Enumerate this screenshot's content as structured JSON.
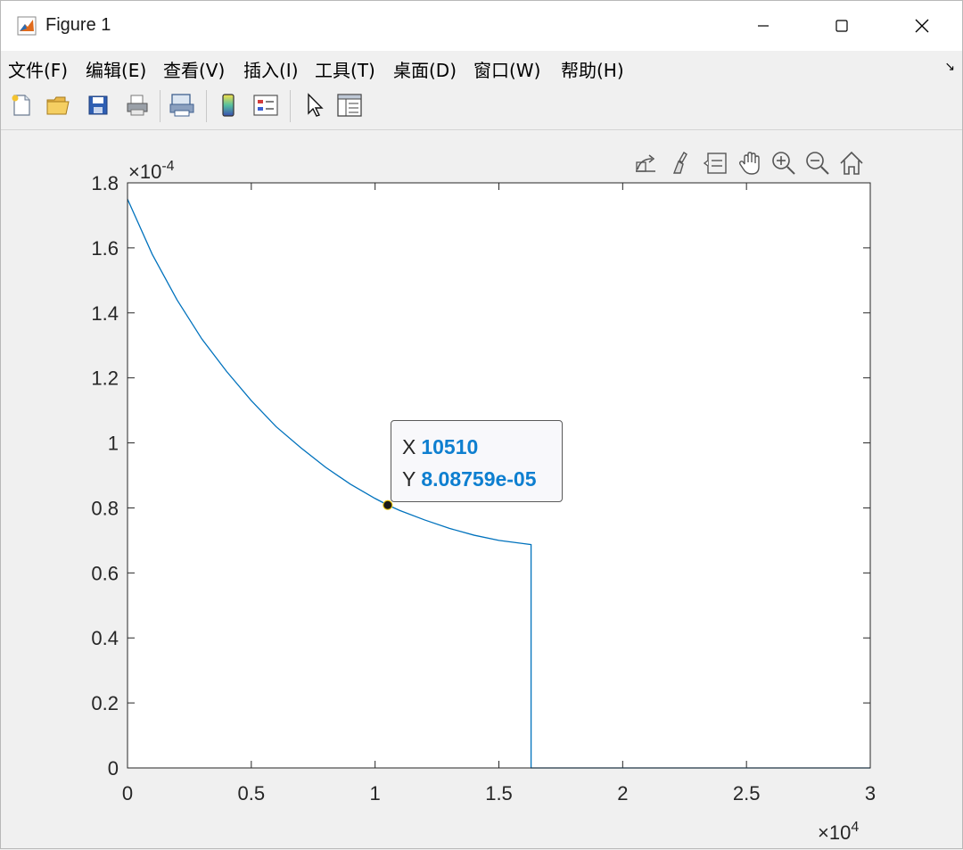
{
  "window": {
    "title": "Figure 1",
    "controls": {
      "minimize": "minimize",
      "maximize": "maximize",
      "close": "close"
    }
  },
  "menu": {
    "items": [
      "文件(F)",
      "编辑(E)",
      "查看(V)",
      "插入(I)",
      "工具(T)",
      "桌面(D)",
      "窗口(W)",
      "帮助(H)"
    ],
    "overflow_glyph": "↘"
  },
  "toolbar": {
    "buttons": [
      "new-figure-icon",
      "open-file-icon",
      "save-icon",
      "print-icon",
      "print-preview-icon",
      "colorbar-icon",
      "legend-icon",
      "edit-plot-icon",
      "property-inspector-icon"
    ]
  },
  "axes_toolbar": {
    "buttons": [
      "export-icon",
      "brush-icon",
      "datatip-icon",
      "pan-icon",
      "zoom-in-icon",
      "zoom-out-icon",
      "home-icon"
    ]
  },
  "colors": {
    "line": "#0072bd",
    "datatip_value": "#0e7fd0",
    "axes": "#262626",
    "background": "#f0f0f0"
  },
  "chart_data": {
    "type": "line",
    "title": "",
    "xlabel": "",
    "ylabel": "",
    "xlim": [
      0,
      30000
    ],
    "ylim": [
      0,
      0.00018
    ],
    "x_ticks": [
      0,
      5000,
      10000,
      15000,
      20000,
      25000,
      30000
    ],
    "x_tick_labels": [
      "0",
      "0.5",
      "1",
      "1.5",
      "2",
      "2.5",
      "3"
    ],
    "x_exponent_base": "×10",
    "x_exponent_power": "4",
    "y_ticks": [
      0,
      2e-05,
      4e-05,
      6e-05,
      8e-05,
      0.0001,
      0.00012,
      0.00014,
      0.00016,
      0.00018
    ],
    "y_tick_labels": [
      "0",
      "0.2",
      "0.4",
      "0.6",
      "0.8",
      "1",
      "1.2",
      "1.4",
      "1.6",
      "1.8"
    ],
    "y_exponent_base": "×10",
    "y_exponent_power": "-4",
    "grid": false,
    "series": [
      {
        "x": [
          0,
          1000,
          2000,
          3000,
          4000,
          5000,
          6000,
          7000,
          8000,
          9000,
          10000,
          10510,
          11000,
          12000,
          13000,
          14000,
          15000,
          16000,
          16300,
          16300,
          17000,
          20000,
          25000,
          30000
        ],
        "y": [
          0.000175,
          0.000158,
          0.000144,
          0.000132,
          0.000122,
          0.000113,
          0.000105,
          9.85e-05,
          9.25e-05,
          8.73e-05,
          8.29e-05,
          8.08759e-05,
          7.92e-05,
          7.63e-05,
          7.37e-05,
          7.16e-05,
          7e-05,
          6.9e-05,
          6.87e-05,
          0,
          0,
          0,
          0,
          0
        ]
      }
    ],
    "datatip": {
      "x_key": "X",
      "x_value": "10510",
      "y_key": "Y",
      "y_value": "8.08759e-05",
      "x": 10510,
      "y": 8.08759e-05
    }
  }
}
